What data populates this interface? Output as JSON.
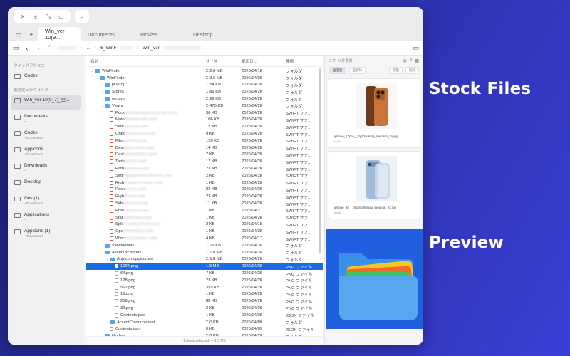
{
  "window": {
    "search_icon": "magnifier",
    "tabs": [
      {
        "label": "Win_ver 10(9..."
      },
      {
        "label": "Documents"
      },
      {
        "label": "Movies"
      },
      {
        "label": "Desktop"
      }
    ]
  },
  "pathbar": {
    "crumbs": [
      "...",
      "6_WinF",
      "Win_ver"
    ]
  },
  "sidebar": {
    "quick_access_title": "クイックアクセス",
    "recent_title": "最近使ったフォルダ",
    "items": [
      {
        "label": "Codex",
        "sub": ""
      },
      {
        "label": "Win_ver 10(9_7)_全...",
        "sub": "~"
      },
      {
        "label": "Documents",
        "sub": "~"
      },
      {
        "label": "Codex",
        "sub": "~/Documents"
      },
      {
        "label": "Appicons",
        "sub": "~/Downloads"
      },
      {
        "label": "Downloads",
        "sub": "~"
      },
      {
        "label": "Desktop",
        "sub": "~"
      },
      {
        "label": "files (1)",
        "sub": "~/Downloads"
      },
      {
        "label": "Applications",
        "sub": "~"
      },
      {
        "label": "Appicons (1)",
        "sub": "~/Downloads"
      }
    ]
  },
  "columns": {
    "name": "名前",
    "size": "サイズ",
    "date": "更新日 ⌄",
    "kind": "種類"
  },
  "rows": [
    {
      "chev": "⌄",
      "type": "folder",
      "name": "WinFinder",
      "size": "Σ 2.6 MB",
      "date": "2026/04/18",
      "kind": "フォルダ",
      "indent": 0
    },
    {
      "chev": "⌄",
      "type": "folder",
      "name": "WinFinder",
      "size": "Σ 2.6 MB",
      "date": "2026/04/28",
      "kind": "フォルダ",
      "indent": 1
    },
    {
      "chev": "›",
      "type": "folder",
      "name": "ja.lproj",
      "size": "Σ 54 KB",
      "date": "2026/04/28",
      "kind": "フォルダ",
      "indent": 2
    },
    {
      "chev": "›",
      "type": "folder",
      "name": "Stores",
      "size": "Σ 89 KB",
      "date": "2026/04/28",
      "kind": "フォルダ",
      "indent": 2
    },
    {
      "chev": "›",
      "type": "folder",
      "name": "en.lproj",
      "size": "Σ 29 KB",
      "date": "2026/04/28",
      "kind": "フォルダ",
      "indent": 2
    },
    {
      "chev": "⌄",
      "type": "folder",
      "name": "Views",
      "size": "Σ 475 KB",
      "date": "2026/04/28",
      "kind": "フォルダ",
      "indent": 2
    },
    {
      "chev": "",
      "type": "swift",
      "name": "Pock",
      "blur": "etFileBrowserController.swift",
      "size": "30 KB",
      "date": "2026/04/28",
      "kind": "SWIFT ファ...",
      "indent": 3
    },
    {
      "chev": "",
      "type": "swift",
      "name": "Main",
      "blur": "WindowView.swift",
      "size": "106 KB",
      "date": "2026/04/28",
      "kind": "SWIFT ファ...",
      "indent": 3
    },
    {
      "chev": "",
      "type": "swift",
      "name": "Setti",
      "blur": "ngsView.swift",
      "size": "12 KB",
      "date": "2026/04/28",
      "kind": "SWIFT ファ...",
      "indent": 3
    },
    {
      "chev": "",
      "type": "swift",
      "name": "Onbo",
      "blur": "ardingView.swift",
      "size": "9 KB",
      "date": "2026/04/28",
      "kind": "SWIFT ファ...",
      "indent": 3
    },
    {
      "chev": "",
      "type": "swift",
      "name": "FileL",
      "blur": "istView.swift",
      "size": "128 KB",
      "date": "2026/04/28",
      "kind": "SWIFT ファ...",
      "indent": 3
    },
    {
      "chev": "",
      "type": "swift",
      "name": "Dest",
      "blur": "inationView.swift",
      "size": "14 KB",
      "date": "2026/04/28",
      "kind": "SWIFT ファ...",
      "indent": 3
    },
    {
      "chev": "",
      "type": "swift",
      "name": "Dest",
      "blur": "inationPicker.swift",
      "size": "7 KB",
      "date": "2026/04/28",
      "kind": "SWIFT ファ...",
      "indent": 3
    },
    {
      "chev": "",
      "type": "swift",
      "name": "Tabb",
      "blur": "arView.swift",
      "size": "17 KB",
      "date": "2026/04/28",
      "kind": "SWIFT ファ...",
      "indent": 3
    },
    {
      "chev": "",
      "type": "swift",
      "name": "Path",
      "blur": "BarView.swift",
      "size": "23 KB",
      "date": "2026/04/28",
      "kind": "SWIFT ファ...",
      "indent": 3
    },
    {
      "chev": "",
      "type": "swift",
      "name": "Setti",
      "blur": "ngsWindowController.swift",
      "size": "2 KB",
      "date": "2026/04/28",
      "kind": "SWIFT ファ...",
      "indent": 3
    },
    {
      "chev": "",
      "type": "swift",
      "name": "Righ",
      "blur": "tPanelController.swift",
      "size": "1 KB",
      "date": "2026/04/28",
      "kind": "SWIFT ファ...",
      "indent": 3
    },
    {
      "chev": "",
      "type": "swift",
      "name": "Pock",
      "blur": "etView.swift",
      "size": "83 KB",
      "date": "2026/04/28",
      "kind": "SWIFT ファ...",
      "indent": 3
    },
    {
      "chev": "",
      "type": "swift",
      "name": "Righ",
      "blur": "tPanel.swift",
      "size": "23 KB",
      "date": "2026/04/28",
      "kind": "SWIFT ファ...",
      "indent": 3
    },
    {
      "chev": "",
      "type": "swift",
      "name": "Side",
      "blur": "barView.swift",
      "size": "11 KB",
      "date": "2026/04/28",
      "kind": "SWIFT ファ...",
      "indent": 3
    },
    {
      "chev": "",
      "type": "swift",
      "name": "Prev",
      "blur": "iewView.swift",
      "size": "1 KB",
      "date": "2026/04/21",
      "kind": "SWIFT ファ...",
      "indent": 3
    },
    {
      "chev": "",
      "type": "swift",
      "name": "Stat",
      "blur": "usBarView.swift",
      "size": "1 KB",
      "date": "2026/04/28",
      "kind": "SWIFT ファ...",
      "indent": 3
    },
    {
      "chev": "",
      "type": "swift",
      "name": "Split",
      "blur": "ContainerView.swift",
      "size": "2 KB",
      "date": "2026/04/18",
      "kind": "SWIFT ファ...",
      "indent": 3
    },
    {
      "chev": "",
      "type": "swift",
      "name": "Ope",
      "blur": "nWithMenu.swift",
      "size": "1 KB",
      "date": "2026/04/28",
      "kind": "SWIFT ファ...",
      "indent": 3
    },
    {
      "chev": "",
      "type": "swift",
      "name": "Winc",
      "blur": "owController.swift",
      "size": "4 KB",
      "date": "2026/04/17",
      "kind": "SWIFT ファ...",
      "indent": 3
    },
    {
      "chev": "›",
      "type": "folder",
      "name": "ViewModels",
      "size": "Σ 79 KB",
      "date": "2026/04/26",
      "kind": "フォルダ",
      "indent": 2
    },
    {
      "chev": "⌄",
      "type": "folder",
      "name": "Assets.xcassets",
      "size": "Σ 1.8 MB",
      "date": "2026/04/24",
      "kind": "フォルダ",
      "indent": 2
    },
    {
      "chev": "⌄",
      "type": "folder",
      "name": "AppIcon.appiconset",
      "size": "Σ 1.8 MB",
      "date": "2026/04/28",
      "kind": "フォルダ",
      "indent": 3
    },
    {
      "chev": "",
      "type": "png",
      "name": "1024.png",
      "size": "1.3 MB",
      "date": "2026/04/28",
      "kind": "PNG ファイル",
      "indent": 4,
      "selected": true
    },
    {
      "chev": "",
      "type": "png",
      "name": "64.png",
      "size": "7 KB",
      "date": "2026/04/28",
      "kind": "PNG ファイル",
      "indent": 4
    },
    {
      "chev": "",
      "type": "png",
      "name": "128.png",
      "size": "23 KB",
      "date": "2026/04/28",
      "kind": "PNG ファイル",
      "indent": 4
    },
    {
      "chev": "",
      "type": "png",
      "name": "512.png",
      "size": "355 KB",
      "date": "2026/04/28",
      "kind": "PNG ファイル",
      "indent": 4
    },
    {
      "chev": "",
      "type": "png",
      "name": "16.png",
      "size": "1 KB",
      "date": "2026/04/28",
      "kind": "PNG ファイル",
      "indent": 4
    },
    {
      "chev": "",
      "type": "png",
      "name": "256.png",
      "size": "88 KB",
      "date": "2026/04/28",
      "kind": "PNG ファイル",
      "indent": 4
    },
    {
      "chev": "",
      "type": "png",
      "name": "32.png",
      "size": "2 KB",
      "date": "2026/04/28",
      "kind": "PNG ファイル",
      "indent": 4
    },
    {
      "chev": "",
      "type": "json",
      "name": "Contents.json",
      "size": "1 KB",
      "date": "2026/04/28",
      "kind": "JSON ファイル",
      "indent": 4
    },
    {
      "chev": "›",
      "type": "folder",
      "name": "AccentColor.colorset",
      "size": "Σ 0 KB",
      "date": "2026/04/09",
      "kind": "フォルダ",
      "indent": 3
    },
    {
      "chev": "",
      "type": "json",
      "name": "Contents.json",
      "size": "0 KB",
      "date": "2026/04/09",
      "kind": "JSON ファイル",
      "indent": 3
    },
    {
      "chev": "›",
      "type": "folder",
      "name": "Models",
      "size": "Σ 8 KB",
      "date": "2026/04/28",
      "kind": "フォルダ",
      "indent": 2
    }
  ],
  "status": "1 items selected — 1.3 MB",
  "right_panel": {
    "count": "2 件",
    "selected_count": "0 件選択",
    "filters": [
      "全選択",
      "全解除",
      "移動",
      "削除"
    ],
    "cards": [
      {
        "caption": "iphone_17pro__f1jt62ixakqa_medium_2x.jpg",
        "sub": "stock",
        "accent": "#b8632a"
      },
      {
        "caption": "iphone_air__b5qmp05vjiqq_medium_2x.jpg",
        "sub": "stock",
        "accent": "#9fbcd9"
      }
    ]
  },
  "labels": {
    "stock_files": "Stock Files",
    "preview": "Preview"
  }
}
